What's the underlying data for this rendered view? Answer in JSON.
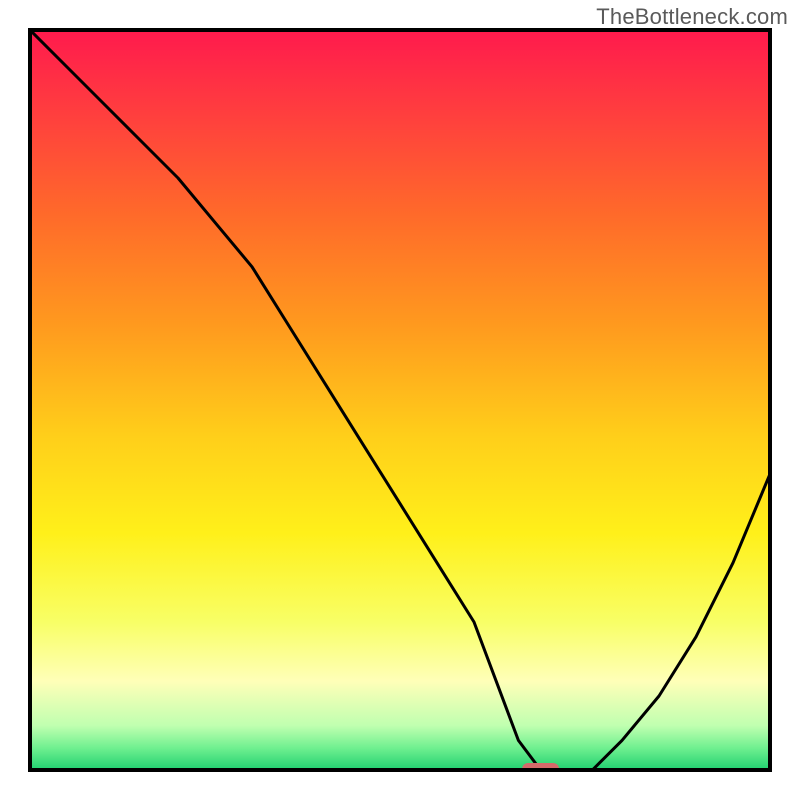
{
  "watermark": "TheBottleneck.com",
  "chart_data": {
    "type": "line",
    "title": "",
    "xlabel": "",
    "ylabel": "",
    "xlim": [
      0,
      100
    ],
    "ylim": [
      0,
      100
    ],
    "series": [
      {
        "name": "bottleneck-curve",
        "x": [
          0,
          5,
          10,
          15,
          20,
          25,
          30,
          35,
          40,
          45,
          50,
          55,
          60,
          63,
          66,
          69,
          72,
          76,
          80,
          85,
          90,
          95,
          100
        ],
        "y": [
          100,
          95,
          90,
          85,
          80,
          74,
          68,
          60,
          52,
          44,
          36,
          28,
          20,
          12,
          4,
          0,
          0,
          0,
          4,
          10,
          18,
          28,
          40
        ]
      }
    ],
    "marker": {
      "name": "optimal-range-pill",
      "x_center": 69,
      "y": 0,
      "width": 5,
      "color": "#d46a6a"
    },
    "gradient_bands": [
      {
        "y_pct": 0,
        "color": "#ff1a4d"
      },
      {
        "y_pct": 10,
        "color": "#ff3a40"
      },
      {
        "y_pct": 25,
        "color": "#ff6a2a"
      },
      {
        "y_pct": 40,
        "color": "#ff9a1e"
      },
      {
        "y_pct": 55,
        "color": "#ffcf1a"
      },
      {
        "y_pct": 68,
        "color": "#fff01a"
      },
      {
        "y_pct": 80,
        "color": "#f8ff66"
      },
      {
        "y_pct": 88,
        "color": "#ffffb8"
      },
      {
        "y_pct": 94,
        "color": "#c0ffb0"
      },
      {
        "y_pct": 97,
        "color": "#70f090"
      },
      {
        "y_pct": 100,
        "color": "#20d070"
      }
    ],
    "frame_color": "#000000"
  }
}
